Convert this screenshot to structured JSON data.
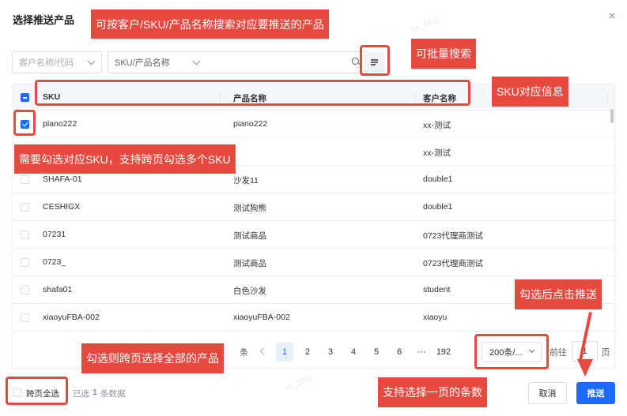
{
  "dialog": {
    "title": "选择推送产品",
    "close_icon": "×"
  },
  "search": {
    "customer_placeholder": "客户名称/代码",
    "field_type": "SKU/产品名称",
    "keyword": ""
  },
  "table": {
    "columns": [
      "SKU",
      "产品名称",
      "客户名称"
    ],
    "rows": [
      {
        "sku": "piano222",
        "name": "piano222",
        "customer": "xx-测试",
        "checked": true
      },
      {
        "sku": "",
        "name": "",
        "customer": "xx-测试",
        "checked": false
      },
      {
        "sku": "SHAFA-01",
        "name": "沙发11",
        "customer": "double1",
        "checked": false
      },
      {
        "sku": "CESHIGX",
        "name": "测试狗熊",
        "customer": "double1",
        "checked": false
      },
      {
        "sku": "07231",
        "name": "测试商品",
        "customer": "0723代理商测试",
        "checked": false
      },
      {
        "sku": "0723_",
        "name": "测试商品",
        "customer": "0723代理商测试",
        "checked": false
      },
      {
        "sku": "shafa01",
        "name": "白色沙发",
        "customer": "student",
        "checked": false
      },
      {
        "sku": "xiaoyuFBA-002",
        "name": "xiaoyuFBA-002",
        "customer": "xiaoyu",
        "checked": false
      }
    ]
  },
  "pagination": {
    "total_suffix": "条",
    "pages": [
      "1",
      "2",
      "3",
      "4",
      "5",
      "6",
      "···",
      "192"
    ],
    "active_page": "1",
    "page_size": "200条/...",
    "goto_label": "前往",
    "goto_value": "1",
    "page_unit": "页"
  },
  "footer": {
    "select_all_label": "跨页全选",
    "selected_prefix": "已选",
    "selected_count": "1",
    "selected_suffix": "条数据",
    "cancel_label": "取消",
    "push_label": "推送"
  },
  "annotations": {
    "search_note": "可按客户/SKU/产品名称搜索对应要推送的产品",
    "batch_note": "可批量搜索",
    "sku_info_note": "SKU对应信息",
    "check_note": "需要勾选对应SKU，支持跨页勾选多个SKU",
    "push_note": "勾选后点击推送",
    "select_all_note": "勾选则跨页选择全部的产品",
    "page_size_note": "支持选择一页的条数"
  },
  "watermark": "xx_1011",
  "colors": {
    "primary": "#1d6aff",
    "annotation": "#e8493f"
  }
}
